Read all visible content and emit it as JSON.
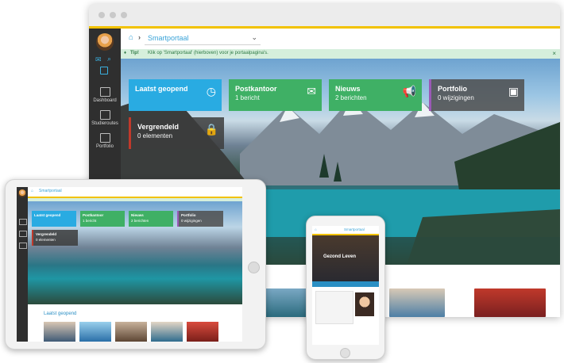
{
  "desktop": {
    "breadcrumb": {
      "selected": "Smartportaal"
    },
    "tip": {
      "label": "Tip!",
      "text": "Klik op 'Smartportaal' (hierboven) voor je portaalpagina's.",
      "close": "×"
    },
    "sidebar": {
      "items": [
        {
          "label": "Dashboard",
          "icon": "dashboard-icon"
        },
        {
          "label": "Studieroutes",
          "icon": "book-icon"
        },
        {
          "label": "Portfolio",
          "icon": "briefcase-icon"
        }
      ]
    },
    "tiles": [
      {
        "title": "Laatst geopend",
        "subtitle": "",
        "icon": "clock-icon",
        "color": "#29abe2"
      },
      {
        "title": "Postkantoor",
        "subtitle": "1 bericht",
        "icon": "envelope-icon",
        "color": "#3fb065"
      },
      {
        "title": "Nieuws",
        "subtitle": "2 berichten",
        "icon": "megaphone-icon",
        "color": "#3fb065"
      },
      {
        "title": "Portfolio",
        "subtitle": "0 wijzigingen",
        "icon": "briefcase-icon",
        "color": "#5a5a5a"
      },
      {
        "title": "Vergrendeld",
        "subtitle": "0 elementen",
        "icon": "lock-icon",
        "color": "#4a4a4a"
      }
    ],
    "accent_colors": {
      "brand_yellow": "#f2c200",
      "blue": "#29abe2",
      "green": "#3fb065",
      "red_marker": "#c0392b",
      "purple_marker": "#9b59b6"
    }
  },
  "tablet": {
    "breadcrumb": "Smartportaal",
    "tiles": [
      {
        "title": "Laatst geopend",
        "subtitle": ""
      },
      {
        "title": "Postkantoor",
        "subtitle": "1 bericht"
      },
      {
        "title": "Nieuws",
        "subtitle": "2 berichten"
      },
      {
        "title": "Portfolio",
        "subtitle": "0 wijzigingen"
      },
      {
        "title": "Vergrendeld",
        "subtitle": "0 elementen"
      }
    ],
    "section_title": "Laatst geopend"
  },
  "phone": {
    "breadcrumb": "Smartportaal",
    "hero_title": "Gezond Leven"
  }
}
